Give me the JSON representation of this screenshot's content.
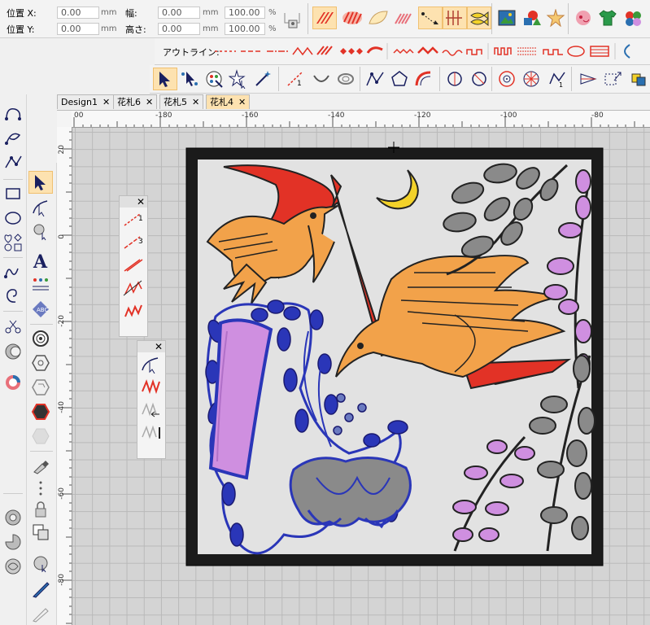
{
  "props": {
    "pos_x_label": "位置 X:",
    "pos_y_label": "位置 Y:",
    "pos_x_value": "0.00",
    "pos_y_value": "0.00",
    "width_label": "幅:",
    "height_label": "高さ:",
    "width_value": "0.00",
    "height_value": "0.00",
    "width_pct": "100.00",
    "height_pct": "100.00",
    "unit_mm": "mm",
    "unit_pct": "%"
  },
  "outline_label": "アウトライン:",
  "tabs": [
    {
      "label": "Design1",
      "close": "✕"
    },
    {
      "label": "花札6",
      "close": "✕"
    },
    {
      "label": "花札5",
      "close": "✕"
    },
    {
      "label": "花札4",
      "close": "✕"
    }
  ],
  "ruler_top": [
    "00",
    "-180",
    "-160",
    "-140",
    "-120",
    "-100",
    "-80"
  ],
  "ruler_left": [
    "20",
    "0",
    "-20",
    "-40",
    "-60",
    "-80"
  ],
  "palette1": {
    "close": "✕",
    "items": [
      "1",
      "3"
    ]
  },
  "palette2": {
    "close": "✕"
  },
  "colors": {
    "accent": "#fde2b0",
    "frame": "#1b1b1b",
    "red": "#e23226",
    "orange": "#f2a24a",
    "blue": "#2a36b8",
    "pink": "#cf8fe0",
    "gray": "#8a8a8a",
    "yellow": "#f3d22a"
  },
  "icons": [
    "select-arrow-icon",
    "node-edit-icon",
    "text-a-icon",
    "circle-icon",
    "hexagon-icon",
    "zoom-icon",
    "close-icon"
  ]
}
